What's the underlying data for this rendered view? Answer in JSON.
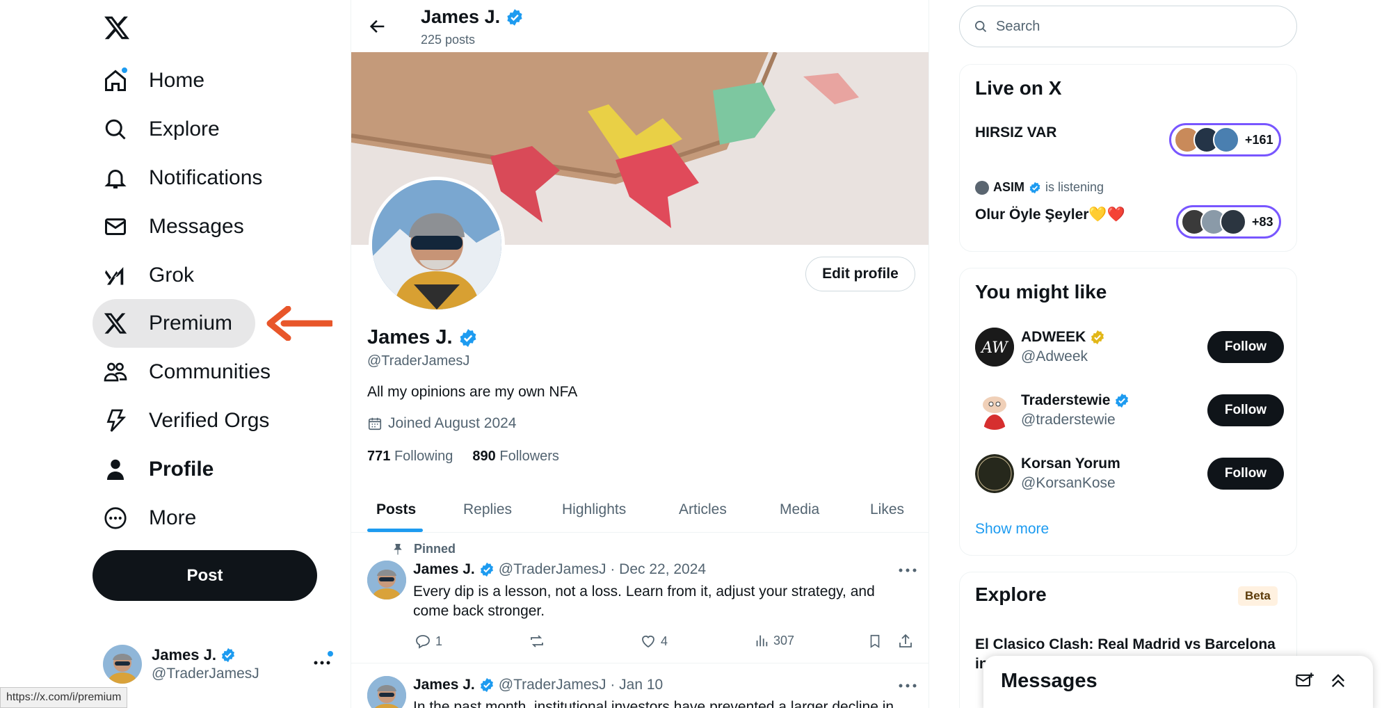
{
  "nav": {
    "items": [
      {
        "label": "Home",
        "icon": "home-icon"
      },
      {
        "label": "Explore",
        "icon": "search-icon"
      },
      {
        "label": "Notifications",
        "icon": "bell-icon"
      },
      {
        "label": "Messages",
        "icon": "mail-icon"
      },
      {
        "label": "Grok",
        "icon": "grok-icon"
      },
      {
        "label": "Premium",
        "icon": "x-logo-icon"
      },
      {
        "label": "Communities",
        "icon": "communities-icon"
      },
      {
        "label": "Verified Orgs",
        "icon": "lightning-icon"
      },
      {
        "label": "Profile",
        "icon": "person-icon"
      },
      {
        "label": "More",
        "icon": "more-circle-icon"
      }
    ],
    "post_label": "Post",
    "account": {
      "name": "James J.",
      "handle": "@TraderJamesJ"
    },
    "status_url": "https://x.com/i/premium"
  },
  "header": {
    "title": "James J.",
    "subtitle": "225 posts"
  },
  "profile": {
    "edit_label": "Edit profile",
    "name": "James J.",
    "handle": "@TraderJamesJ",
    "bio": "All my opinions are my own NFA",
    "joined": "Joined August 2024",
    "following_count": "771",
    "following_label": "Following",
    "followers_count": "890",
    "followers_label": "Followers"
  },
  "tabs": [
    "Posts",
    "Replies",
    "Highlights",
    "Articles",
    "Media",
    "Likes"
  ],
  "posts": [
    {
      "pinned_label": "Pinned",
      "name": "James J.",
      "meta": "@TraderJamesJ · Dec 22, 2024",
      "text": "Every dip is a lesson, not a loss. Learn from it, adjust your strategy, and come back stronger.",
      "replies": "1",
      "likes": "4",
      "views": "307"
    },
    {
      "name": "James J.",
      "meta": "@TraderJamesJ · Jan 10",
      "text": "In the past month, institutional investors have prevented a larger decline in"
    }
  ],
  "search": {
    "placeholder": "Search"
  },
  "live": {
    "title": "Live on X",
    "spaces": [
      {
        "title": "HIRSIZ VAR",
        "count": "+161"
      },
      {
        "host": "ASIM",
        "status": "is listening",
        "title": "Olur Öyle Şeyler💛❤️",
        "count": "+83"
      }
    ]
  },
  "suggest": {
    "title": "You might like",
    "people": [
      {
        "name": "ADWEEK",
        "handle": "@Adweek",
        "follow": "Follow",
        "badge": "gold"
      },
      {
        "name": "Traderstewie",
        "handle": "@traderstewie",
        "follow": "Follow",
        "badge": "blue"
      },
      {
        "name": "Korsan Yorum",
        "handle": "@KorsanKose",
        "follow": "Follow",
        "badge": "none"
      }
    ],
    "show_more": "Show more"
  },
  "explore": {
    "title": "Explore",
    "badge": "Beta",
    "trend": "El Clasico Clash: Real Madrid vs Barcelona in"
  },
  "messages_drawer": {
    "title": "Messages"
  },
  "colors": {
    "accent": "#1d9bf0",
    "annotation_arrow": "#e8562a",
    "space_pill": "#7856ff"
  }
}
